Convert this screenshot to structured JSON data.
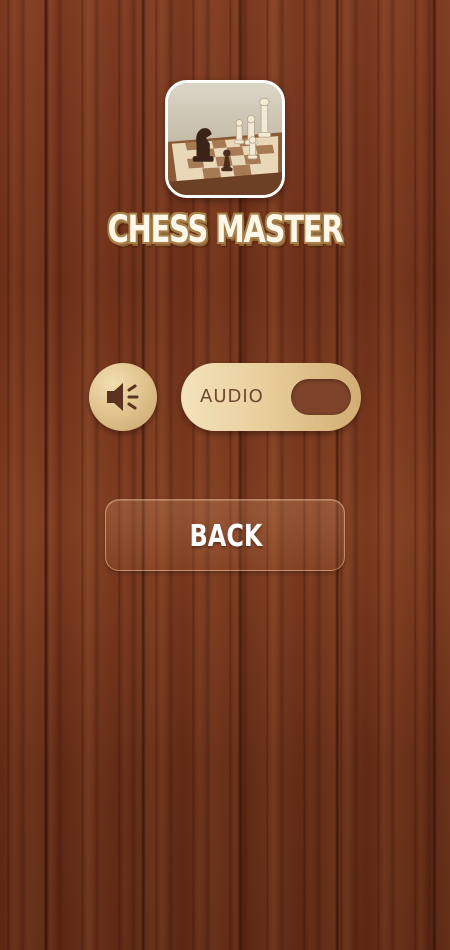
{
  "app": {
    "title": "CHESS MASTER",
    "icon": "chess-board-icon"
  },
  "controls": {
    "sound_icon": "speaker-icon",
    "audio_label": "AUDIO",
    "audio_enabled": true
  },
  "buttons": {
    "back_label": "BACK"
  },
  "colors": {
    "background_wood": "#6e3118",
    "gold": "#e0c28c",
    "toggle_knob": "#7c4329",
    "title_outline": "#a9804a"
  }
}
